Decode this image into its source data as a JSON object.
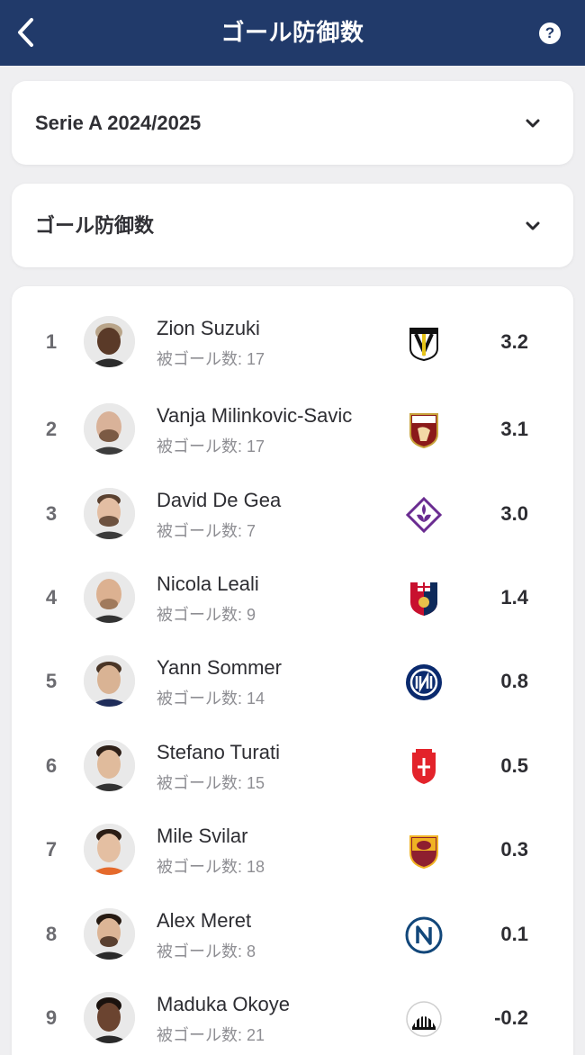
{
  "header": {
    "title": "ゴール防御数",
    "help_label": "?"
  },
  "filters": {
    "season": "Serie A 2024/2025",
    "stat": "ゴール防御数"
  },
  "players": [
    {
      "rank": "1",
      "name": "Zion Suzuki",
      "sub": "被ゴール数: 17",
      "team": "Parma",
      "value": "3.2"
    },
    {
      "rank": "2",
      "name": "Vanja Milinkovic-Savic",
      "sub": "被ゴール数: 17",
      "team": "Torino",
      "value": "3.1"
    },
    {
      "rank": "3",
      "name": "David De Gea",
      "sub": "被ゴール数: 7",
      "team": "Fiorentina",
      "value": "3.0"
    },
    {
      "rank": "4",
      "name": "Nicola Leali",
      "sub": "被ゴール数: 9",
      "team": "Genoa",
      "value": "1.4"
    },
    {
      "rank": "5",
      "name": "Yann Sommer",
      "sub": "被ゴール数: 14",
      "team": "Inter",
      "value": "0.8"
    },
    {
      "rank": "6",
      "name": "Stefano Turati",
      "sub": "被ゴール数: 15",
      "team": "Monza",
      "value": "0.5"
    },
    {
      "rank": "7",
      "name": "Mile Svilar",
      "sub": "被ゴール数: 18",
      "team": "Roma",
      "value": "0.3"
    },
    {
      "rank": "8",
      "name": "Alex Meret",
      "sub": "被ゴール数: 8",
      "team": "Napoli",
      "value": "0.1"
    },
    {
      "rank": "9",
      "name": "Maduka Okoye",
      "sub": "被ゴール数: 21",
      "team": "Udinese",
      "value": "-0.2"
    }
  ],
  "colors": {
    "header_bg": "#213a6a",
    "page_bg": "#efeff1",
    "card_bg": "#ffffff"
  }
}
